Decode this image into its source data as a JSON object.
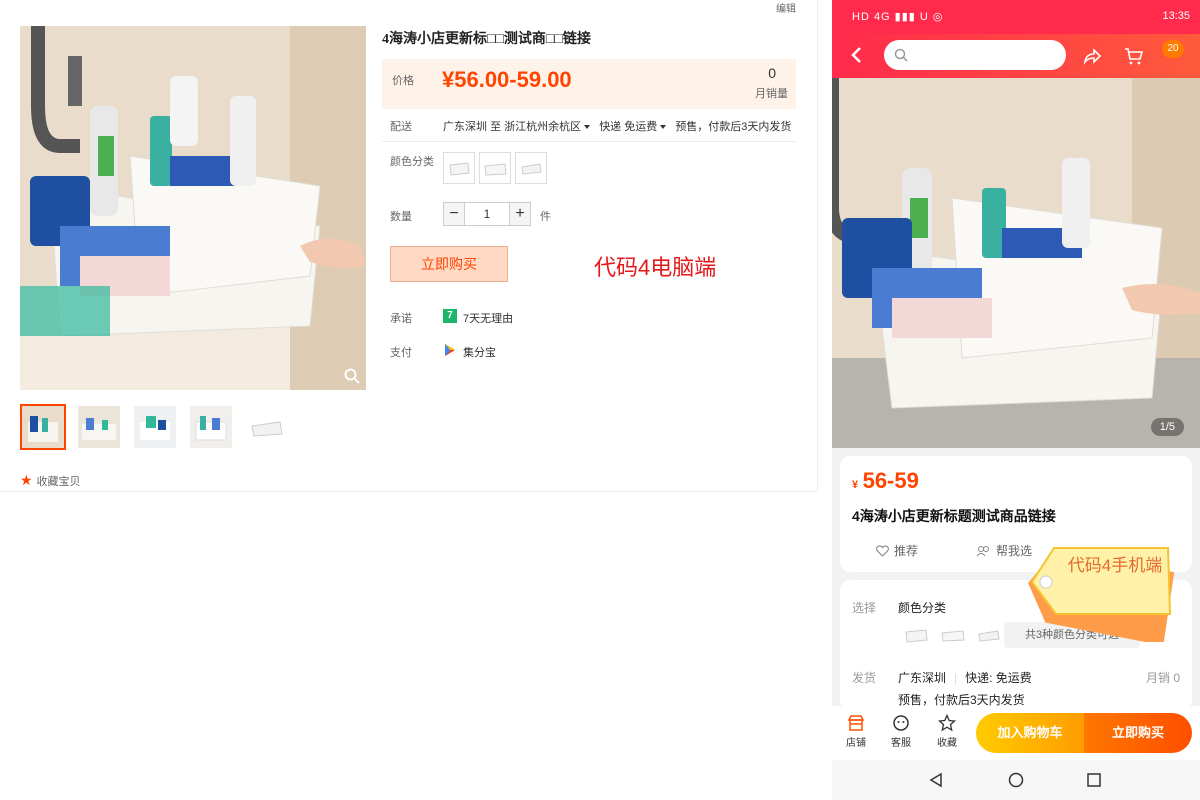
{
  "desktop": {
    "edit_link": "编辑",
    "title": "4海涛小店更新标□□测试商□□链接",
    "price_label": "价格",
    "price": "¥56.00-59.00",
    "monthly_sales_count": "0",
    "monthly_sales_label": "月销量",
    "shipping_label": "配送",
    "ship_from": "广东深圳",
    "ship_to_word": "至",
    "ship_to": "浙江杭州余杭区",
    "express": "快递 免运费",
    "presale": "预售，付款后3天内发货",
    "color_label": "颜色分类",
    "qty_label": "数量",
    "qty_value": "1",
    "qty_minus": "−",
    "qty_plus": "+",
    "qty_unit": "件",
    "buy_now": "立即购买",
    "code_label": "代码4电脑端",
    "promise_label": "承诺",
    "promise_icon_text": "7",
    "promise_text": "7天无理由",
    "pay_label": "支付",
    "pay_text": "集分宝",
    "favorite": "收藏宝贝"
  },
  "mobile": {
    "status_left": "HD 4G ▮▮▮ U ◎",
    "status_time": "13:35",
    "cart_badge": "20",
    "image_counter": "1/5",
    "price_symbol": "¥",
    "price": "56-59",
    "title": "4海涛小店更新标题测试商品链接",
    "recommend": "推荐",
    "help_select": "帮我选",
    "select_label": "选择",
    "color_label": "颜色分类",
    "color_count": "共3种颜色分类可选",
    "ship_label": "发货",
    "ship_from": "广东深圳",
    "express": "快递: 免运费",
    "monthly_sales": "月销 0",
    "presale": "预售，付款后3天内发货",
    "tag_text": "代码4手机端",
    "bottom_shop": "店铺",
    "bottom_service": "客服",
    "bottom_fav": "收藏",
    "add_cart": "加入购物车",
    "buy_now": "立即购买"
  },
  "colors": {
    "taobao_orange": "#ff4400",
    "header_red": "#ff2a4c",
    "code_red": "#e41a1a"
  }
}
